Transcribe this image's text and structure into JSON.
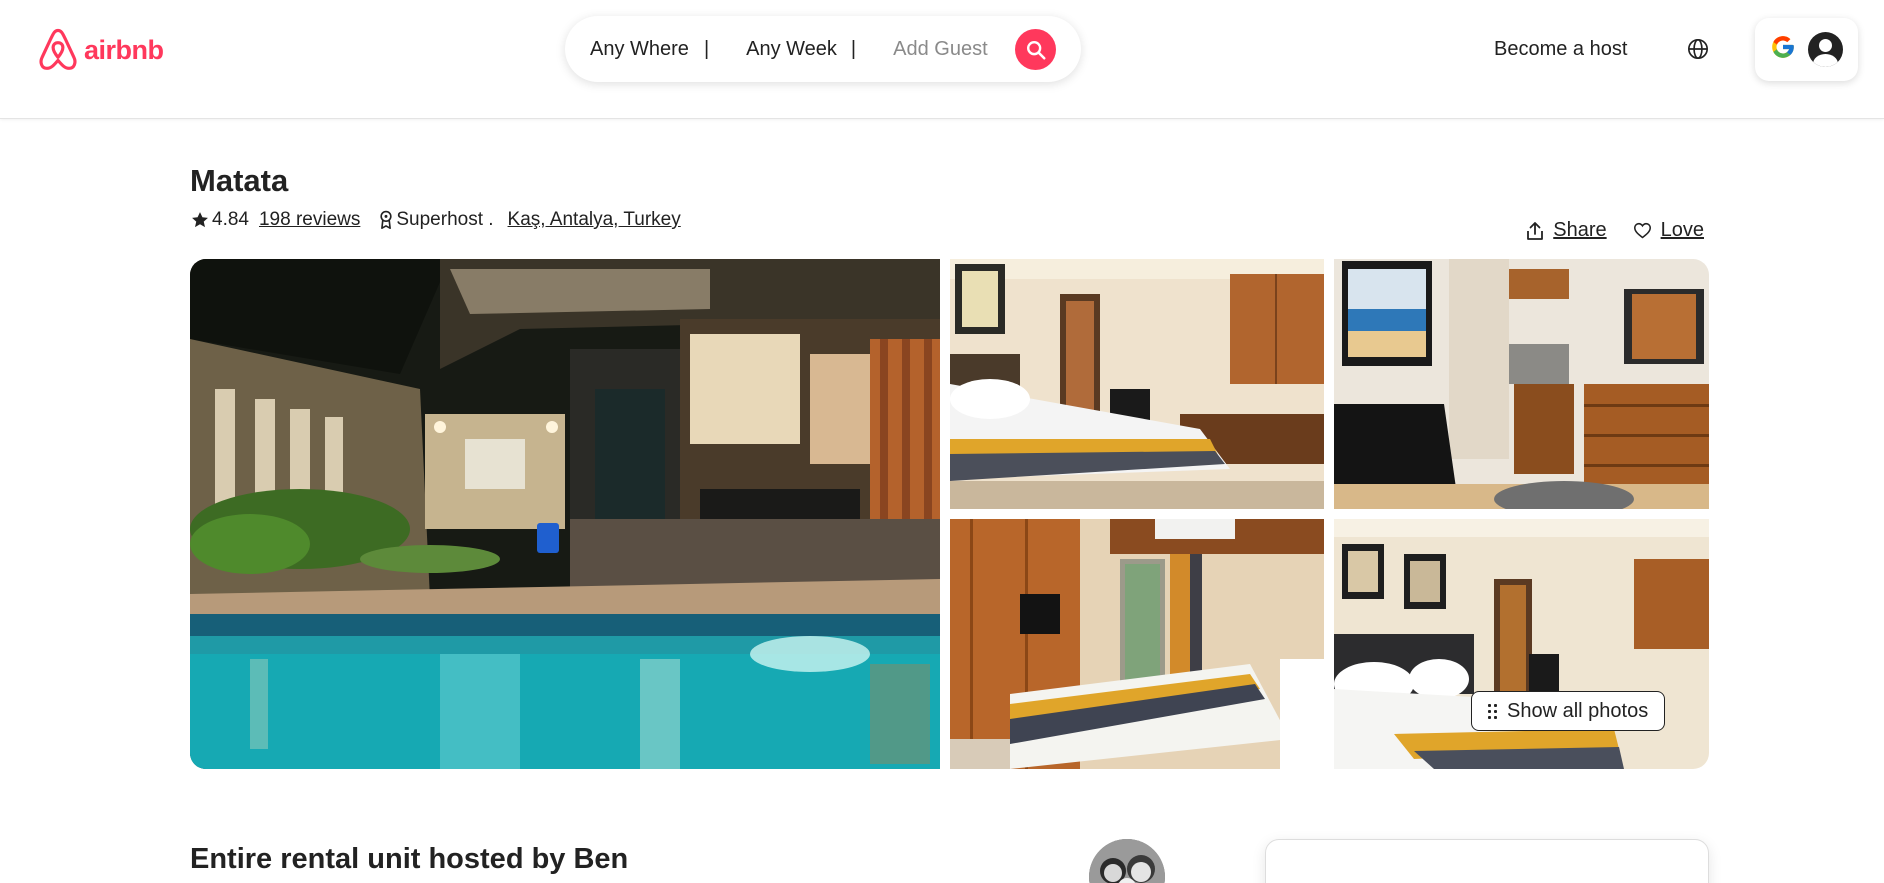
{
  "header": {
    "logo_text": "airbnb",
    "brand_color": "#ff385c",
    "search": {
      "where_label": "Any Where",
      "week_label": "Any Week",
      "separator": "|",
      "guest_placeholder": "Add Guest",
      "search_icon": "search-icon"
    },
    "become_host_label": "Become a host",
    "globe_icon": "globe-icon",
    "user_menu": {
      "google_letter": "G",
      "avatar_icon": "user-avatar-icon"
    }
  },
  "listing": {
    "title": "Matata",
    "rating": "4.84",
    "reviews_label": "198 reviews",
    "superhost_label": "Superhost .",
    "location_label": "Kaş, Antalya, Turkey",
    "share_label": "Share",
    "love_label": "Love"
  },
  "gallery": {
    "photos": [
      {
        "name": "pool-exterior-night"
      },
      {
        "name": "bedroom-with-desk"
      },
      {
        "name": "kitchenette-with-painting"
      },
      {
        "name": "bedroom-with-tv"
      },
      {
        "name": "bedroom-with-framed-art"
      }
    ],
    "show_all_label": "Show all photos"
  },
  "details": {
    "hosted_by_title": "Entire rental unit hosted by Ben"
  }
}
